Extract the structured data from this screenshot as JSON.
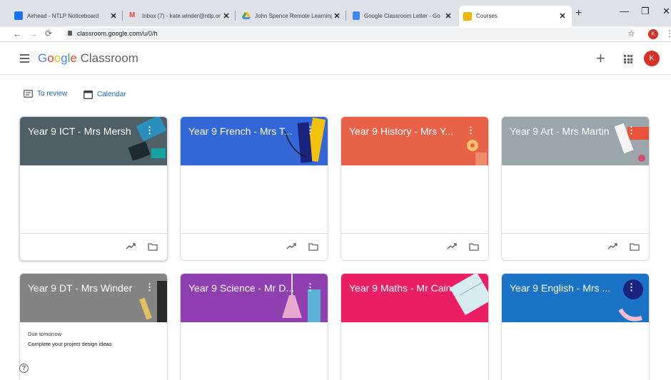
{
  "browser": {
    "tabs": [
      {
        "title": "Airhead - NTLP Noticeboard",
        "icon": "airhead-icon",
        "color": "#1a73e8"
      },
      {
        "title": "Inbox (7) - kate.winder@ntlp.or",
        "icon": "gmail-icon",
        "color": "#ea4335"
      },
      {
        "title": "John Spence Remote Learning",
        "icon": "drive-icon",
        "color": "#fbbc05"
      },
      {
        "title": "Google Classroom Letter - Go",
        "icon": "docs-icon",
        "color": "#4285f4"
      },
      {
        "title": "Courses",
        "icon": "classroom-icon",
        "color": "#f4b400"
      }
    ],
    "new_tab": "+",
    "url": "classroom.google.com/u/0/h",
    "profile_initial": "K"
  },
  "header": {
    "logo_google": "Google",
    "logo_product": "Classroom",
    "avatar_initial": "K",
    "create_label": "+"
  },
  "subnav": {
    "to_review": "To review",
    "calendar": "Calendar"
  },
  "cards": [
    {
      "title": "Year 9 ICT - Mrs Mersh",
      "color": "#4f5f66"
    },
    {
      "title": "Year 9 French - Mrs T...",
      "color": "#3367d6"
    },
    {
      "title": "Year 9 History - Mrs Y...",
      "color": "#e8624a"
    },
    {
      "title": "Year 9 Art - Mrs Martin",
      "color": "#9aa6ab"
    },
    {
      "title": "Year 9 DT - Mrs Winder",
      "color": "#848484",
      "due": "Due tomorrow",
      "task": "Complete your project design ideas"
    },
    {
      "title": "Year 9 Science - Mr D...",
      "color": "#8f3fb0"
    },
    {
      "title": "Year 9 Maths - Mr Cain",
      "color": "#e91e63"
    },
    {
      "title": "Year 9 English - Mrs ...",
      "color": "#1a73c5"
    }
  ],
  "help_label": "?"
}
